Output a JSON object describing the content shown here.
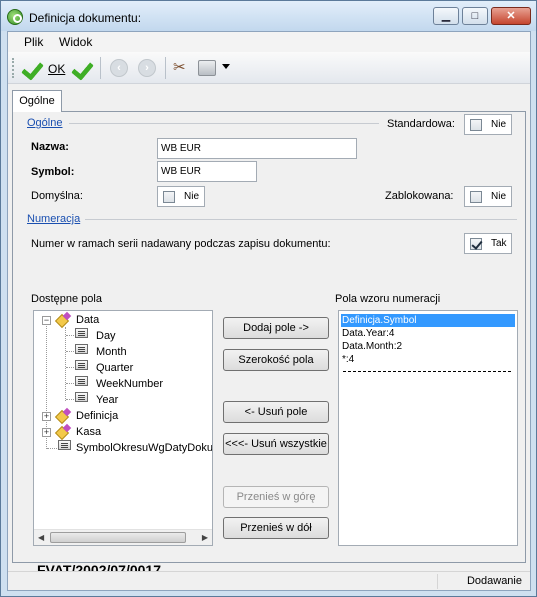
{
  "window": {
    "title": "Definicja dokumentu:"
  },
  "menu": {
    "items": [
      "Plik",
      "Widok"
    ]
  },
  "toolbar": {
    "ok_label": "OK",
    "back_icon": "back-arrow-icon",
    "forward_icon": "forward-arrow-icon"
  },
  "tabs": [
    "Ogólne"
  ],
  "general": {
    "section_label": "Ogólne",
    "standard_label": "Standardowa:",
    "standard_value": "Nie",
    "standard_checked": false,
    "name_label": "Nazwa:",
    "name_value": "WB EUR",
    "symbol_label": "Symbol:",
    "symbol_value": "WB EUR",
    "default_label": "Domyślna:",
    "default_value": "Nie",
    "default_checked": false,
    "blocked_label": "Zablokowana:",
    "blocked_value": "Nie",
    "blocked_checked": false
  },
  "numbering": {
    "section_label": "Numeracja",
    "info_text": "Numer w ramach serii nadawany podczas zapisu dokumentu:",
    "info_value": "Tak",
    "info_checked": true,
    "available_label": "Dostępne pola",
    "pattern_label": "Pola wzoru numeracji",
    "tree": [
      {
        "label": "Data",
        "level": 0,
        "expander": "−",
        "icon": "folder"
      },
      {
        "label": "Day",
        "level": 1,
        "icon": "field"
      },
      {
        "label": "Month",
        "level": 1,
        "icon": "field"
      },
      {
        "label": "Quarter",
        "level": 1,
        "icon": "field"
      },
      {
        "label": "WeekNumber",
        "level": 1,
        "icon": "field"
      },
      {
        "label": "Year",
        "level": 1,
        "icon": "field"
      },
      {
        "label": "Definicja",
        "level": 0,
        "expander": "+",
        "icon": "folder"
      },
      {
        "label": "Kasa",
        "level": 0,
        "expander": "+",
        "icon": "folder"
      },
      {
        "label": "SymbolOkresuWgDatyDoku",
        "level": 0,
        "icon": "field"
      }
    ],
    "buttons": {
      "add": "Dodaj pole ->",
      "width": "Szerokość pola",
      "remove": "<- Usuń pole",
      "remove_all": "<<<- Usuń wszystkie",
      "move_up": "Przenieś w górę",
      "move_down": "Przenieś w dół"
    },
    "pattern_items": [
      "Definicja.Symbol",
      "Data.Year:4",
      "Data.Month:2",
      "*:4"
    ],
    "preview": "FVAT/2002/07/0017"
  },
  "status": {
    "mode": "Dodawanie"
  }
}
